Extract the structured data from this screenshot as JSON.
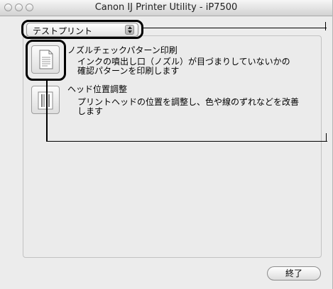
{
  "window": {
    "title": "Canon IJ Printer Utility - iP7500"
  },
  "popup": {
    "selected": "テストプリント"
  },
  "items": [
    {
      "title": "ノズルチェックパターン印刷",
      "description": "インクの噴出し口（ノズル）が目づまりしていないかの\n確認パターンを印刷します",
      "icon": "document-icon"
    },
    {
      "title": "ヘッド位置調整",
      "description": "プリントヘッドの位置を調整し、色や線のずれなどを改善\nします",
      "icon": "print-head-icon"
    }
  ],
  "buttons": {
    "close_label": "終了"
  }
}
